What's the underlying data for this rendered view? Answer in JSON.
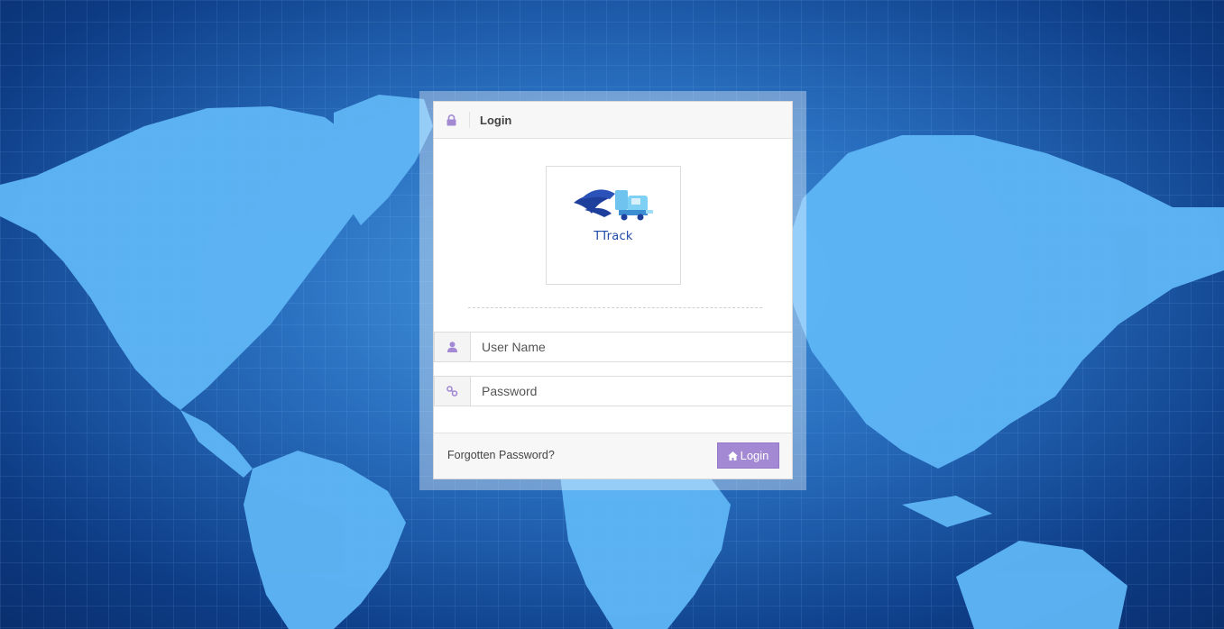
{
  "panel": {
    "title": "Login",
    "header_icon": "lock-icon"
  },
  "logo": {
    "text": "TTrack",
    "icon": "truck-logo"
  },
  "form": {
    "username_placeholder": "User Name",
    "username_icon": "user-icon",
    "password_placeholder": "Password",
    "password_icon": "key-icon"
  },
  "footer": {
    "forgot_label": "Forgotten Password?",
    "login_label": "Login",
    "login_icon": "home-icon"
  },
  "colors": {
    "accent": "#a389d4",
    "background": "#1a5bb0",
    "map": "#5fb6f5"
  }
}
